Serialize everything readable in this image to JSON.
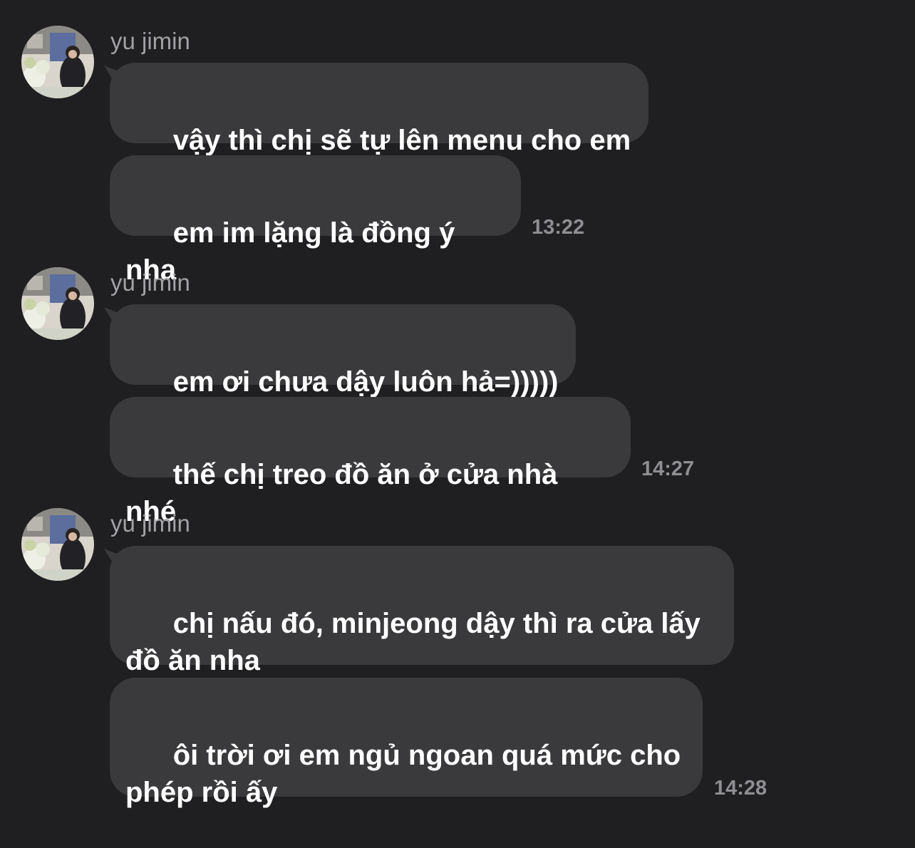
{
  "messages": [
    {
      "sender": "yu jimin",
      "bubbles": [
        "vậy thì chị sẽ tự lên menu cho em",
        "em im lặng là đồng ý nha"
      ],
      "time": "13:22"
    },
    {
      "sender": "yu jimin",
      "bubbles": [
        "em ơi chưa dậy luôn hả=)))))",
        "thế chị treo đồ ăn ở cửa nhà nhé"
      ],
      "time": "14:27"
    },
    {
      "sender": "yu jimin",
      "bubbles": [
        "chị nấu đó, minjeong dậy thì ra cửa lấy đồ ăn nha",
        "ôi trời ơi em ngủ ngoan quá mức cho phép rồi ấy"
      ],
      "time": "14:28"
    }
  ],
  "colors": {
    "background": "#1f1f21",
    "bubble": "#3a3a3c",
    "text": "#ffffff",
    "secondary": "#8e8e93"
  }
}
